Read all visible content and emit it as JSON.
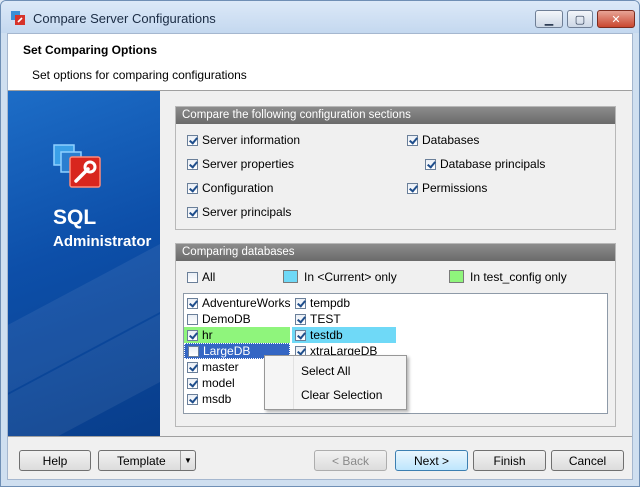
{
  "window": {
    "title": "Compare Server Configurations"
  },
  "header": {
    "title": "Set Comparing Options",
    "subtitle": "Set options for comparing configurations"
  },
  "sidebar": {
    "logo_line1": "SQL",
    "logo_line2": "Administrator"
  },
  "sections_group": {
    "title": "Compare the following configuration sections",
    "items": [
      {
        "label": "Server information",
        "checked": true
      },
      {
        "label": "Server properties",
        "checked": true
      },
      {
        "label": "Configuration",
        "checked": true
      },
      {
        "label": "Server principals",
        "checked": true
      },
      {
        "label": "Databases",
        "checked": true
      },
      {
        "label": "Database principals",
        "checked": true
      },
      {
        "label": "Permissions",
        "checked": true
      }
    ]
  },
  "databases_group": {
    "title": "Comparing databases",
    "all_label": "All",
    "all_checked": false,
    "legend_current": "In <Current> only",
    "legend_test": "In test_config only",
    "color_current": "#6fd9f7",
    "color_test": "#8ff57c",
    "databases": [
      {
        "name": "AdventureWorks",
        "checked": true,
        "status": "both"
      },
      {
        "name": "DemoDB",
        "checked": false,
        "status": "both"
      },
      {
        "name": "hr",
        "checked": true,
        "status": "test_only"
      },
      {
        "name": "LargeDB",
        "checked": false,
        "status": "selected"
      },
      {
        "name": "master",
        "checked": true,
        "status": "both"
      },
      {
        "name": "model",
        "checked": true,
        "status": "both"
      },
      {
        "name": "msdb",
        "checked": true,
        "status": "both"
      },
      {
        "name": "tempdb",
        "checked": true,
        "status": "both"
      },
      {
        "name": "TEST",
        "checked": true,
        "status": "both"
      },
      {
        "name": "testdb",
        "checked": true,
        "status": "current_only"
      },
      {
        "name": "xtraLargeDB",
        "checked": true,
        "status": "both"
      }
    ]
  },
  "context_menu": {
    "items": [
      "Select All",
      "Clear Selection"
    ]
  },
  "buttons": {
    "help": "Help",
    "template": "Template",
    "back": "< Back",
    "next": "Next >",
    "finish": "Finish",
    "cancel": "Cancel"
  }
}
